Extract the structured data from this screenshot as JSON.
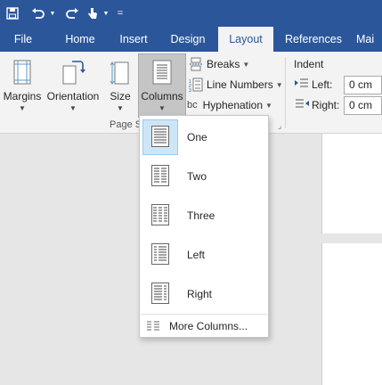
{
  "quick_access": {
    "save": "save-icon",
    "undo": "undo-icon",
    "touch_mode": "touch-mode-icon",
    "customize": "="
  },
  "tabs": [
    {
      "label": "File"
    },
    {
      "label": "Home"
    },
    {
      "label": "Insert"
    },
    {
      "label": "Design"
    },
    {
      "label": "Layout",
      "active": true
    },
    {
      "label": "References"
    },
    {
      "label": "Mai"
    }
  ],
  "ribbon": {
    "margins": "Margins",
    "orientation": "Orientation",
    "size": "Size",
    "columns": "Columns",
    "breaks": "Breaks",
    "line_numbers": "Line Numbers",
    "hyphenation": "Hyphenation",
    "hyphenation_icon_text": "bc",
    "group_label": "Page S",
    "indent_label": "Indent",
    "indent_left_label": "Left:",
    "indent_left_value": "0 cm",
    "indent_right_label": "Right:",
    "indent_right_value": "0 cm"
  },
  "columns_menu": {
    "items": [
      {
        "label": "One",
        "selected": true
      },
      {
        "label": "Two"
      },
      {
        "label": "Three"
      },
      {
        "label": "Left"
      },
      {
        "label": "Right"
      }
    ],
    "more": "More Columns..."
  },
  "colors": {
    "brand": "#2b579a",
    "ribbon_bg": "#f3f3f3",
    "selected_bg": "#cde6f7"
  }
}
